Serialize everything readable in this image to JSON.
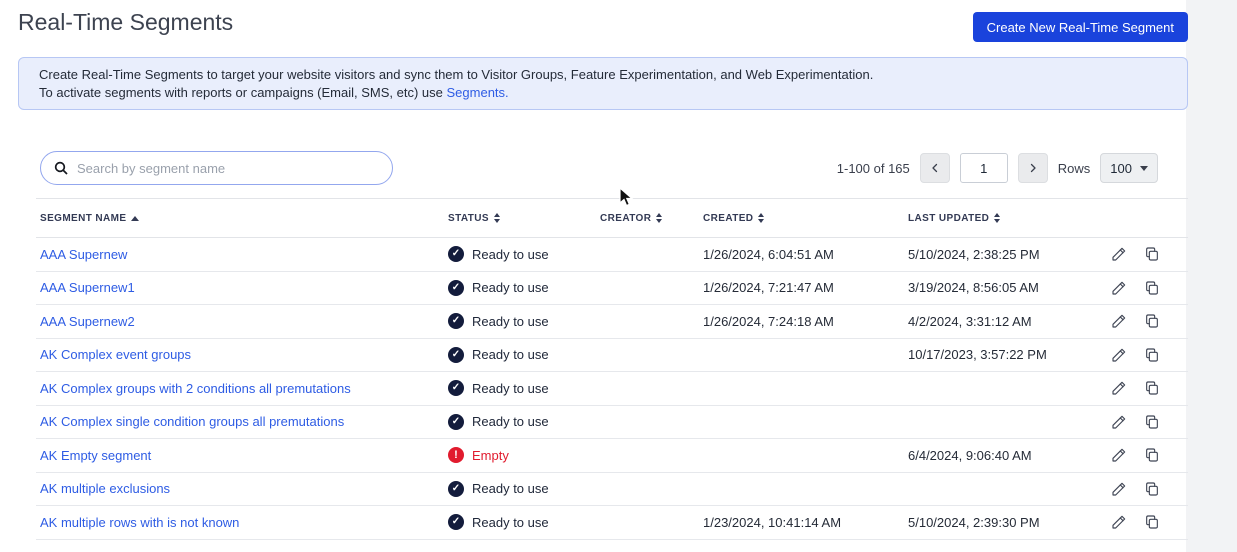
{
  "page": {
    "title": "Real-Time Segments"
  },
  "header": {
    "create_button_label": "Create New Real-Time Segment"
  },
  "banner": {
    "line1": "Create Real-Time Segments to target your website visitors and sync them to Visitor Groups, Feature Experimentation, and Web Experimentation.",
    "line2_prefix": "To activate segments with reports or campaigns (Email, SMS, etc) use ",
    "line2_link": "Segments."
  },
  "toolbar": {
    "search_placeholder": "Search by segment name",
    "pagination": {
      "range": "1-100 of 165",
      "page_value": "1",
      "rows_label": "Rows",
      "rows_value": "100"
    }
  },
  "table": {
    "columns": [
      {
        "label": "SEGMENT NAME",
        "sort": "asc"
      },
      {
        "label": "STATUS",
        "sort": "both"
      },
      {
        "label": "CREATOR",
        "sort": "both"
      },
      {
        "label": "CREATED",
        "sort": "both"
      },
      {
        "label": "LAST UPDATED",
        "sort": "both"
      }
    ],
    "status_icons": {
      "ready": "✓",
      "empty": "!"
    },
    "rows": [
      {
        "name": "AAA Supernew",
        "status": "ready",
        "status_label": "Ready to use",
        "creator": "",
        "created": "1/26/2024, 6:04:51 AM",
        "updated": "5/10/2024, 2:38:25 PM"
      },
      {
        "name": "AAA Supernew1",
        "status": "ready",
        "status_label": "Ready to use",
        "creator": "",
        "created": "1/26/2024, 7:21:47 AM",
        "updated": "3/19/2024, 8:56:05 AM"
      },
      {
        "name": "AAA Supernew2",
        "status": "ready",
        "status_label": "Ready to use",
        "creator": "",
        "created": "1/26/2024, 7:24:18 AM",
        "updated": "4/2/2024, 3:31:12 AM"
      },
      {
        "name": "AK Complex event groups",
        "status": "ready",
        "status_label": "Ready to use",
        "creator": "",
        "created": "",
        "updated": "10/17/2023, 3:57:22 PM"
      },
      {
        "name": "AK Complex groups with 2 conditions all premutations",
        "status": "ready",
        "status_label": "Ready to use",
        "creator": "",
        "created": "",
        "updated": ""
      },
      {
        "name": "AK Complex single condition groups all premutations",
        "status": "ready",
        "status_label": "Ready to use",
        "creator": "",
        "created": "",
        "updated": ""
      },
      {
        "name": "AK Empty segment",
        "status": "empty",
        "status_label": "Empty",
        "creator": "",
        "created": "",
        "updated": "6/4/2024, 9:06:40 AM"
      },
      {
        "name": "AK multiple exclusions",
        "status": "ready",
        "status_label": "Ready to use",
        "creator": "",
        "created": "",
        "updated": ""
      },
      {
        "name": "AK multiple rows with is not known",
        "status": "ready",
        "status_label": "Ready to use",
        "creator": "",
        "created": "1/23/2024, 10:41:14 AM",
        "updated": "5/10/2024, 2:39:30 PM"
      }
    ]
  },
  "colors": {
    "accent_blue": "#1a43dc",
    "link_blue": "#2e5ce4",
    "status_navy": "#131c3c",
    "error_red": "#e11b2e",
    "banner_bg": "#e9eefc",
    "banner_border": "#b7c7f4"
  }
}
